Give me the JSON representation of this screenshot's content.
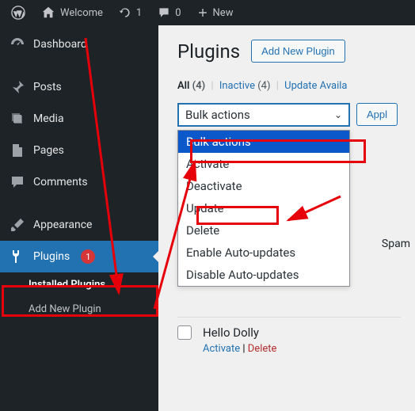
{
  "adminbar": {
    "welcome": "Welcome",
    "updates_count": "1",
    "comments_count": "0",
    "new_label": "New"
  },
  "sidebar": {
    "items": [
      {
        "label": "Dashboard"
      },
      {
        "label": "Posts"
      },
      {
        "label": "Media"
      },
      {
        "label": "Pages"
      },
      {
        "label": "Comments"
      },
      {
        "label": "Appearance"
      },
      {
        "label": "Plugins",
        "badge": "1"
      }
    ],
    "submenu": [
      {
        "label": "Installed Plugins",
        "current": true
      },
      {
        "label": "Add New Plugin"
      }
    ]
  },
  "page": {
    "title": "Plugins",
    "add_new": "Add New Plugin"
  },
  "filters": {
    "all_label": "All",
    "all_count": "(4)",
    "inactive_label": "Inactive",
    "inactive_count": "(4)",
    "update_label": "Update Availa"
  },
  "bulk": {
    "selected": "Bulk actions",
    "options": [
      "Bulk actions",
      "Activate",
      "Deactivate",
      "Update",
      "Delete",
      "Enable Auto-updates",
      "Disable Auto-updates"
    ],
    "apply_label": "Appl"
  },
  "plugin_row": {
    "name": "Hello Dolly",
    "activate": "Activate",
    "delete": "Delete"
  },
  "misc": {
    "spam": "Spam"
  }
}
